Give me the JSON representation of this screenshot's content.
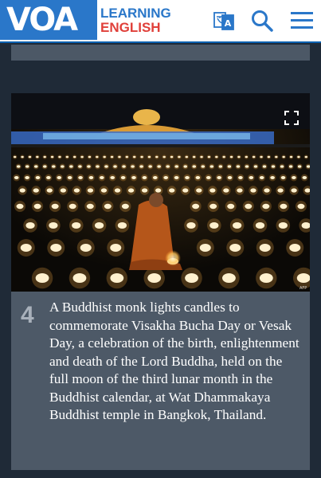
{
  "header": {
    "logo_mark": "VOA",
    "logo_line1": "LEARNING",
    "logo_line2": "ENGLISH",
    "icons": [
      "translate-icon",
      "search-icon",
      "menu-icon"
    ],
    "colors": {
      "brand_blue": "#2a77c9",
      "brand_red": "#e0403a"
    }
  },
  "slide": {
    "number": "4",
    "caption": "A Buddhist monk lights candles to commemorate Visakha Bucha Day or Vesak Day, a celebration of the birth, enlightenment and death of the Lord Buddha, held on the full moon of the third lunar month in the Buddhist calendar, at Wat Dhammakaya Buddhist temple in Bangkok, Thailand.",
    "photo_credit": "AFP"
  }
}
